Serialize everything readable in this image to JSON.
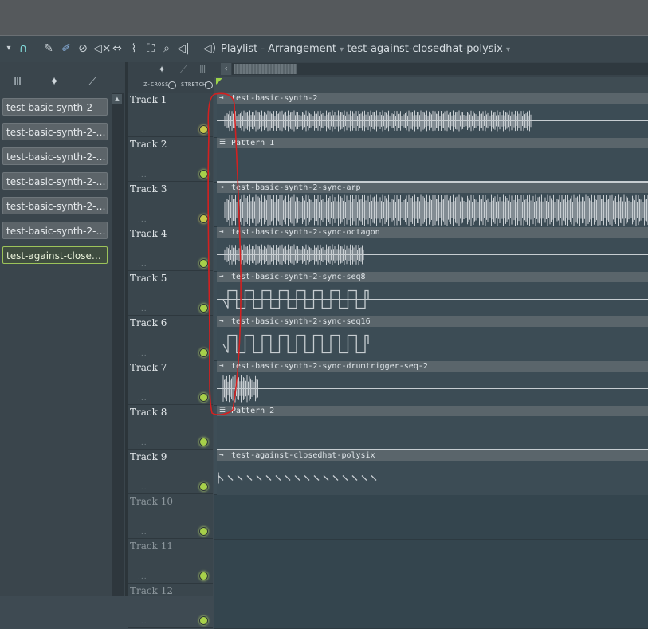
{
  "toolbar": {
    "title": "Playlist - Arrangement",
    "pattern": "test-against-closedhat-polysix",
    "icons": [
      "dropdown-arrow-icon",
      "magnet-icon",
      "pencil-icon",
      "paint-icon",
      "delete-icon",
      "mute-icon",
      "slip-icon",
      "slice-icon",
      "select-icon",
      "zoom-icon",
      "playback-icon",
      "speaker-icon"
    ]
  },
  "browser": {
    "tabs": [
      "piano-roll-icon",
      "audio-icon",
      "automation-icon"
    ],
    "patterns": [
      {
        "label": "test-basic-synth-2",
        "selected": false
      },
      {
        "label": "test-basic-synth-2-sync..",
        "selected": false
      },
      {
        "label": "test-basic-synth-2-sync..",
        "selected": false
      },
      {
        "label": "test-basic-synth-2-sync..",
        "selected": false
      },
      {
        "label": "test-basic-synth-2-sync..",
        "selected": false
      },
      {
        "label": "test-basic-synth-2-sync..",
        "selected": false
      },
      {
        "label": "test-against-closedhat-..",
        "selected": true
      }
    ]
  },
  "options": {
    "zcross": "Z-CROSS",
    "stretch": "STRETCH"
  },
  "tracks": [
    {
      "name": "Track 1",
      "led": "yellow",
      "clip": "test-basic-synth-2",
      "clip_type": "audio"
    },
    {
      "name": "Track 2",
      "led": "green",
      "clip": "Pattern 1",
      "clip_type": "pattern"
    },
    {
      "name": "Track 3",
      "led": "yellow",
      "clip": "test-basic-synth-2-sync-arp",
      "clip_type": "audio"
    },
    {
      "name": "Track 4",
      "led": "green",
      "clip": "test-basic-synth-2-sync-octagon",
      "clip_type": "audio"
    },
    {
      "name": "Track 5",
      "led": "green",
      "clip": "test-basic-synth-2-sync-seq8",
      "clip_type": "audio"
    },
    {
      "name": "Track 6",
      "led": "green",
      "clip": "test-basic-synth-2-sync-seq16",
      "clip_type": "audio"
    },
    {
      "name": "Track 7",
      "led": "green",
      "clip": "test-basic-synth-2-sync-drumtrigger-seq-2",
      "clip_type": "audio"
    },
    {
      "name": "Track 8",
      "led": "green",
      "clip": "Pattern 2",
      "clip_type": "pattern"
    },
    {
      "name": "Track 9",
      "led": "green",
      "clip": "test-against-closedhat-polysix",
      "clip_type": "audio"
    },
    {
      "name": "Track 10",
      "led": "green",
      "clip": "",
      "clip_type": "none"
    },
    {
      "name": "Track 11",
      "led": "green",
      "clip": "",
      "clip_type": "none"
    },
    {
      "name": "Track 12",
      "led": "green",
      "clip": "",
      "clip_type": "none"
    }
  ],
  "colors": {
    "led_green": "#a7d04a",
    "led_yellow": "#c7c84a",
    "selected_border": "#9cc35a",
    "annotation": "#d42020"
  }
}
